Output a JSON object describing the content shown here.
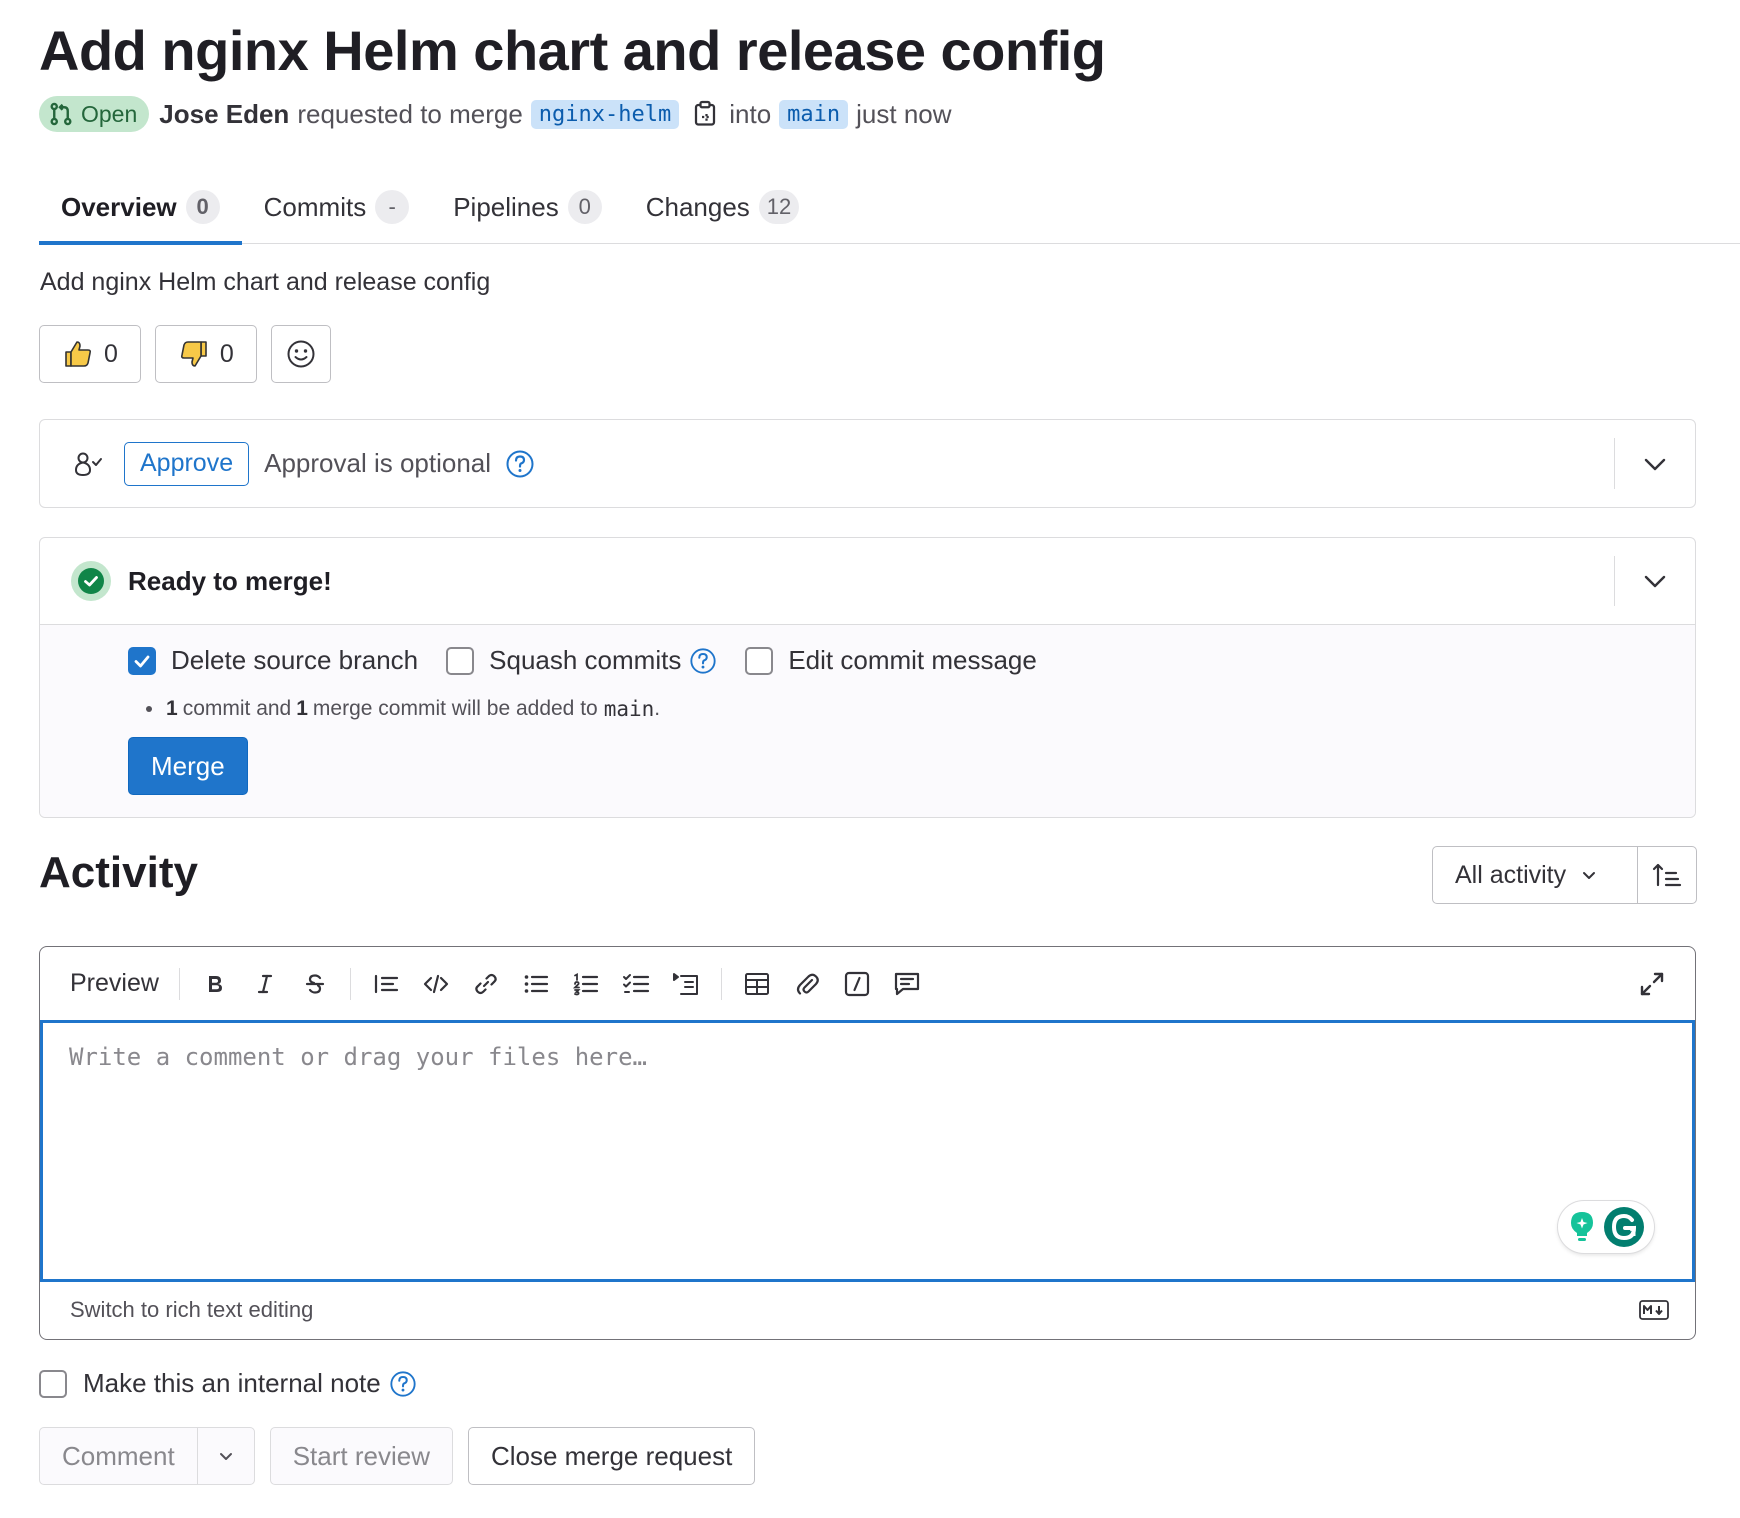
{
  "merge_request": {
    "title": "Add nginx Helm chart and release config",
    "state": "Open",
    "author": "Jose Eden",
    "requested_text": "requested to merge",
    "source_branch": "nginx-helm",
    "into_text": "into",
    "target_branch": "main",
    "time": "just now",
    "description": "Add nginx Helm chart and release config"
  },
  "tabs": [
    {
      "label": "Overview",
      "count": "0"
    },
    {
      "label": "Commits",
      "count": "-"
    },
    {
      "label": "Pipelines",
      "count": "0"
    },
    {
      "label": "Changes",
      "count": "12"
    }
  ],
  "reactions": {
    "thumbs_up": "0",
    "thumbs_down": "0"
  },
  "approval": {
    "button_label": "Approve",
    "status_text": "Approval is optional"
  },
  "merge_widget": {
    "status": "Ready to merge!",
    "delete_source_branch": "Delete source branch",
    "delete_source_branch_checked": true,
    "squash_commits": "Squash commits",
    "edit_commit_message": "Edit commit message",
    "commit_count": "1",
    "commit_text": "commit and",
    "merge_commit_count": "1",
    "merge_commit_text": "merge commit will be added to",
    "target_branch": "main",
    "period": ".",
    "merge_button": "Merge"
  },
  "activity": {
    "heading": "Activity",
    "filter": "All activity"
  },
  "editor": {
    "preview_tab": "Preview",
    "placeholder": "Write a comment or drag your files here…",
    "switch_text": "Switch to rich text editing"
  },
  "comment_form": {
    "internal_note": "Make this an internal note",
    "comment_button": "Comment",
    "start_review": "Start review",
    "close_mr": "Close merge request"
  },
  "colors": {
    "accent": "#1f75cb",
    "success": "#108548",
    "open_badge_bg": "#c3e6cd"
  }
}
